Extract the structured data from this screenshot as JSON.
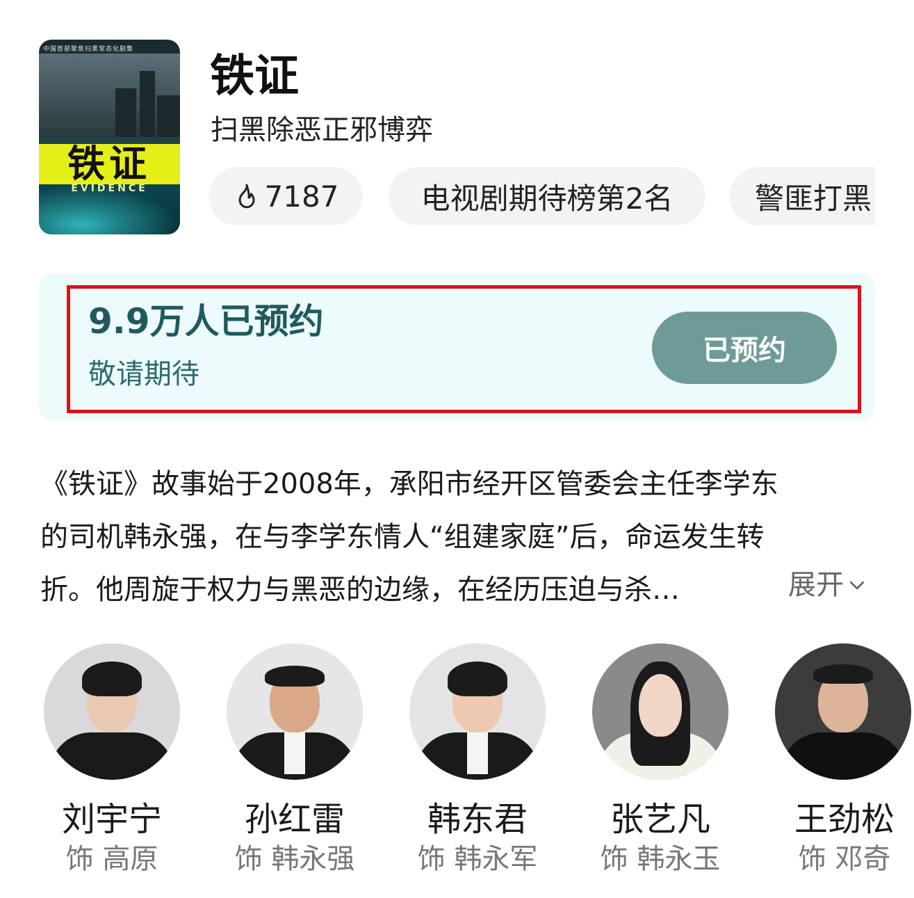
{
  "show": {
    "poster": {
      "tagline": "中国首部聚焦扫黑常态化剧集",
      "logo_text": "铁证",
      "logo_en": "EVIDENCE"
    },
    "title": "铁证",
    "subtitle": "扫黑除恶正邪博弈",
    "tags": {
      "hot_icon": "flame-icon",
      "hot_value": "7187",
      "rank": "电视剧期待榜第2名",
      "genre": "警匪打黑"
    }
  },
  "reservation": {
    "count_text": "9.9万人已预约",
    "sub_text": "敬请期待",
    "button_label": "已预约",
    "colors": {
      "card_bg": "#edfbfc",
      "button_bg": "#6e9b98",
      "highlight": "#e0101a"
    }
  },
  "synopsis": {
    "lines": [
      "《铁证》故事始于2008年，承阳市经开区管委会主任李学东",
      "的司机韩永强，在与李学东情人“组建家庭”后，命运发生转",
      "折。他周旋于权力与黑恶的边缘，在经历压迫与杀…"
    ],
    "expand_label": "展开"
  },
  "cast": [
    {
      "name": "刘宇宁",
      "role": "饰 高原"
    },
    {
      "name": "孙红雷",
      "role": "饰 韩永强"
    },
    {
      "name": "韩东君",
      "role": "饰 韩永军"
    },
    {
      "name": "张艺凡",
      "role": "饰 韩永玉"
    },
    {
      "name": "王劲松",
      "role": "饰 邓奇"
    }
  ]
}
